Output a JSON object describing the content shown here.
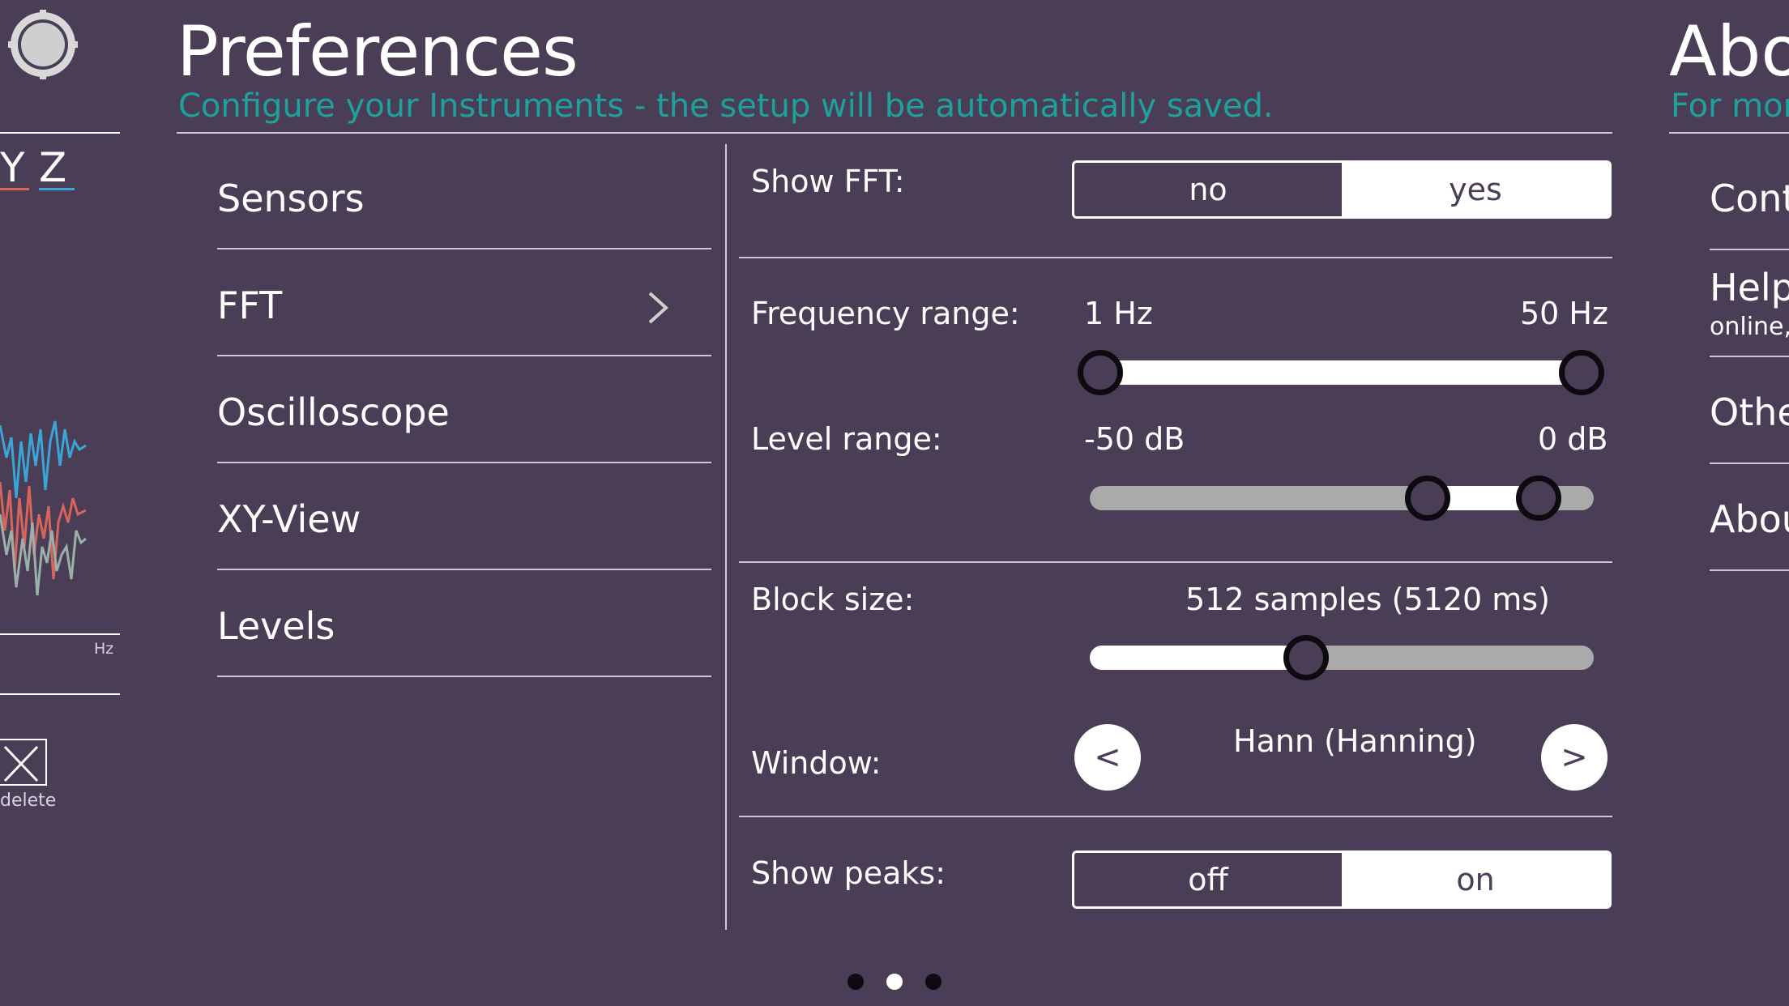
{
  "header": {
    "title": "Preferences",
    "subtitle": "Configure your Instruments - the setup will be automatically saved."
  },
  "menu": [
    {
      "label": "Sensors"
    },
    {
      "label": "FFT"
    },
    {
      "label": "Oscilloscope"
    },
    {
      "label": "XY-View"
    },
    {
      "label": "Levels"
    }
  ],
  "left_panel": {
    "axis_y": "Y",
    "axis_z": "Z",
    "unit": "Hz",
    "delete_label": "delete"
  },
  "settings": {
    "show_fft": {
      "label": "Show FFT:",
      "options": [
        "no",
        "yes"
      ],
      "selected": "yes"
    },
    "frequency_range": {
      "label": "Frequency range:",
      "min_label": "1 Hz",
      "max_label": "50 Hz",
      "low_fraction": 0.0,
      "high_fraction": 1.0
    },
    "level_range": {
      "label": "Level range:",
      "min_label": "-50 dB",
      "max_label": "0 dB",
      "low_fraction": 0.67,
      "high_fraction": 0.89
    },
    "block_size": {
      "label": "Block size:",
      "value": "512 samples (5120 ms)",
      "fraction": 0.43
    },
    "window": {
      "label": "Window:",
      "value": "Hann (Hanning)",
      "prev": "<",
      "next": ">"
    },
    "show_peaks": {
      "label": "Show peaks:",
      "options": [
        "off",
        "on"
      ],
      "selected": "on"
    }
  },
  "right_panel": {
    "title": "Abo",
    "subtitle": "For mor",
    "items": [
      "Cont",
      "Help",
      "Othe",
      "Abou"
    ],
    "help_sub": "online,"
  },
  "pager": {
    "count": 3,
    "active": 1
  },
  "colors": {
    "background": "#4a3e56",
    "accent": "#1fa19b",
    "trace_red": "#d8655c",
    "trace_blue": "#3aa6d8",
    "trace_gray": "#9ab0a8"
  }
}
